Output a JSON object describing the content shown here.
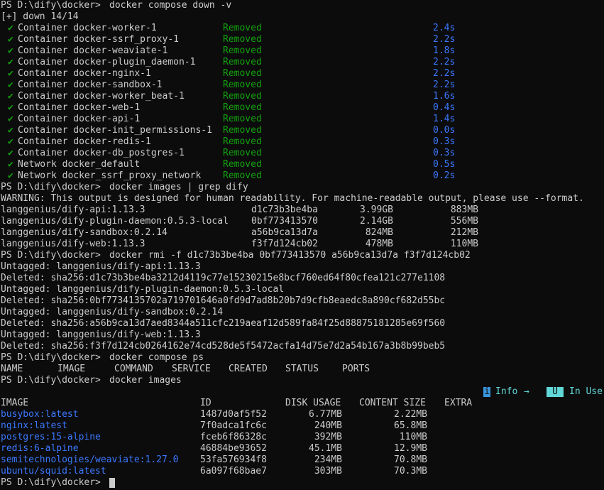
{
  "prompt": "PS D:\\dify\\docker>",
  "cmd_down": "docker compose down -v",
  "down_header": "[+] down 14/14",
  "check_glyph": "✔",
  "down_rows": [
    {
      "kind": "Container",
      "name": "docker-worker-1",
      "status": "Removed",
      "time": "2.4s"
    },
    {
      "kind": "Container",
      "name": "docker-ssrf_proxy-1",
      "status": "Removed",
      "time": "2.2s"
    },
    {
      "kind": "Container",
      "name": "docker-weaviate-1",
      "status": "Removed",
      "time": "1.8s"
    },
    {
      "kind": "Container",
      "name": "docker-plugin_daemon-1",
      "status": "Removed",
      "time": "2.2s"
    },
    {
      "kind": "Container",
      "name": "docker-nginx-1",
      "status": "Removed",
      "time": "2.2s"
    },
    {
      "kind": "Container",
      "name": "docker-sandbox-1",
      "status": "Removed",
      "time": "2.2s"
    },
    {
      "kind": "Container",
      "name": "docker-worker_beat-1",
      "status": "Removed",
      "time": "1.6s"
    },
    {
      "kind": "Container",
      "name": "docker-web-1",
      "status": "Removed",
      "time": "0.4s"
    },
    {
      "kind": "Container",
      "name": "docker-api-1",
      "status": "Removed",
      "time": "1.4s"
    },
    {
      "kind": "Container",
      "name": "docker-init_permissions-1",
      "status": "Removed",
      "time": "0.0s"
    },
    {
      "kind": "Container",
      "name": "docker-redis-1",
      "status": "Removed",
      "time": "0.3s"
    },
    {
      "kind": "Container",
      "name": "docker-db_postgres-1",
      "status": "Removed",
      "time": "0.3s"
    },
    {
      "kind": "Network",
      "name": "docker_default",
      "status": "Removed",
      "time": "0.5s"
    },
    {
      "kind": "Network",
      "name": "docker_ssrf_proxy_network",
      "status": "Removed",
      "time": "0.2s"
    }
  ],
  "cmd_images_grep": "docker images | grep dify",
  "warning": "WARNING: This output is designed for human readability. For machine-readable output, please use --format.",
  "grep_rows": [
    {
      "image": "langgenius/dify-api:1.13.3",
      "id": "d1c73b3be4ba",
      "disk": "3.99GB",
      "content": "883MB"
    },
    {
      "image": "langgenius/dify-plugin-daemon:0.5.3-local",
      "id": "0bf773413570",
      "disk": "2.14GB",
      "content": "556MB"
    },
    {
      "image": "langgenius/dify-sandbox:0.2.14",
      "id": "a56b9ca13d7a",
      "disk": "824MB",
      "content": "212MB"
    },
    {
      "image": "langgenius/dify-web:1.13.3",
      "id": "f3f7d124cb02",
      "disk": "478MB",
      "content": "110MB"
    }
  ],
  "cmd_rmi": "docker rmi -f d1c73b3be4ba 0bf773413570 a56b9ca13d7a f3f7d124cb02",
  "rmi_output": [
    "Untagged: langgenius/dify-api:1.13.3",
    "Deleted: sha256:d1c73b3be4ba3212d4119c77e15230215e8bcf760ed64f80cfea121c277e1108",
    "Untagged: langgenius/dify-plugin-daemon:0.5.3-local",
    "Deleted: sha256:0bf7734135702a719701646a0fd9d7ad8b20b7d9cfb8eaedc8a890cf682d55bc",
    "Untagged: langgenius/dify-sandbox:0.2.14",
    "Deleted: sha256:a56b9ca13d7aed8344a511cfc219aeaf12d589fa84f25d88875181285e69f560",
    "Untagged: langgenius/dify-web:1.13.3",
    "Deleted: sha256:f3f7d124cb0264162e74cd528de5f5472acfa14d75e7d2a54b167a3b8b99beb5"
  ],
  "cmd_ps": "docker compose ps",
  "ps_header": [
    "NAME",
    "IMAGE",
    "COMMAND",
    "SERVICE",
    "CREATED",
    "STATUS",
    "PORTS"
  ],
  "cmd_images": "docker images",
  "hint": {
    "i_badge": "i",
    "info": "Info",
    "arrow": "→",
    "u_badge": "U",
    "in_use": "In Use"
  },
  "images_header": {
    "image": "IMAGE",
    "id": "ID",
    "disk": "DISK USAGE",
    "content": "CONTENT SIZE",
    "extra": "EXTRA"
  },
  "images_rows": [
    {
      "image": "busybox:latest",
      "id": "1487d0af5f52",
      "disk": "6.77MB",
      "content": "2.22MB"
    },
    {
      "image": "nginx:latest",
      "id": "7f0adca1fc6c",
      "disk": "240MB",
      "content": "65.8MB"
    },
    {
      "image": "postgres:15-alpine",
      "id": "fceb6f86328c",
      "disk": "392MB",
      "content": "110MB"
    },
    {
      "image": "redis:6-alpine",
      "id": "46884be93652",
      "disk": "45.1MB",
      "content": "12.9MB"
    },
    {
      "image": "semitechnologies/weaviate:1.27.0",
      "id": "53fa576934f8",
      "disk": "234MB",
      "content": "70.8MB"
    },
    {
      "image": "ubuntu/squid:latest",
      "id": "6a097f68bae7",
      "disk": "303MB",
      "content": "70.3MB"
    }
  ]
}
